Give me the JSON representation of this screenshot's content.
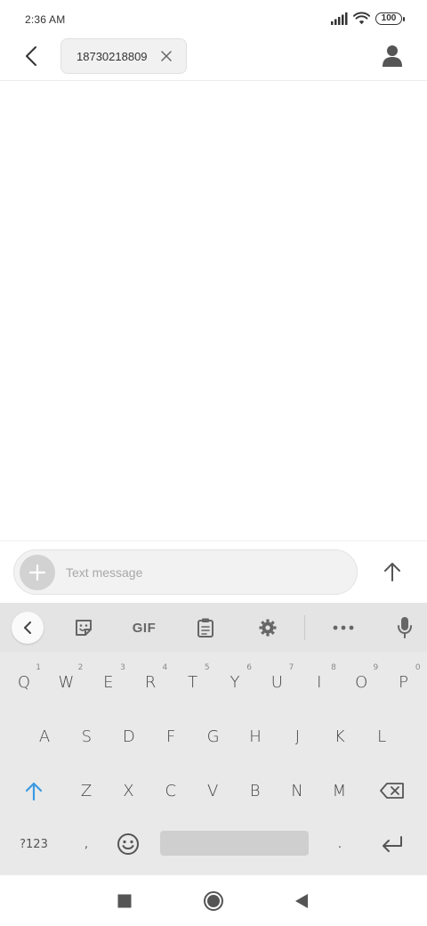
{
  "status_bar": {
    "time": "2:36 AM",
    "battery": "100"
  },
  "header": {
    "recipient": "18730218809"
  },
  "compose": {
    "placeholder": "Text message"
  },
  "keyboard": {
    "toolbar": {
      "gif_label": "GIF"
    },
    "row1": [
      {
        "label": "Q",
        "hint": "1"
      },
      {
        "label": "W",
        "hint": "2"
      },
      {
        "label": "E",
        "hint": "3"
      },
      {
        "label": "R",
        "hint": "4"
      },
      {
        "label": "T",
        "hint": "5"
      },
      {
        "label": "Y",
        "hint": "6"
      },
      {
        "label": "U",
        "hint": "7"
      },
      {
        "label": "I",
        "hint": "8"
      },
      {
        "label": "O",
        "hint": "9"
      },
      {
        "label": "P",
        "hint": "0"
      }
    ],
    "row2": [
      "A",
      "S",
      "D",
      "F",
      "G",
      "H",
      "J",
      "K",
      "L"
    ],
    "row3": [
      "Z",
      "X",
      "C",
      "V",
      "B",
      "N",
      "M"
    ],
    "bottom": {
      "symbols_label": "?123",
      "comma": ",",
      "period": "."
    }
  },
  "icons": {
    "back": "back-arrow-icon",
    "chip_remove": "close-icon",
    "contact": "person-icon",
    "attach": "plus-icon",
    "send": "arrow-up-icon",
    "collapse": "chevron-left-icon",
    "sticker": "sticker-icon",
    "clipboard": "clipboard-icon",
    "settings": "gear-icon",
    "more": "more-horizontal-icon",
    "mic": "microphone-icon",
    "shift": "shift-icon",
    "backspace": "backspace-icon",
    "emoji": "emoji-icon",
    "enter": "enter-icon",
    "recents": "square-icon",
    "home": "circle-icon",
    "nav_back": "triangle-back-icon"
  },
  "colors": {
    "accent": "#3b9ae1",
    "keyboard_bg": "#e9e9e9"
  }
}
